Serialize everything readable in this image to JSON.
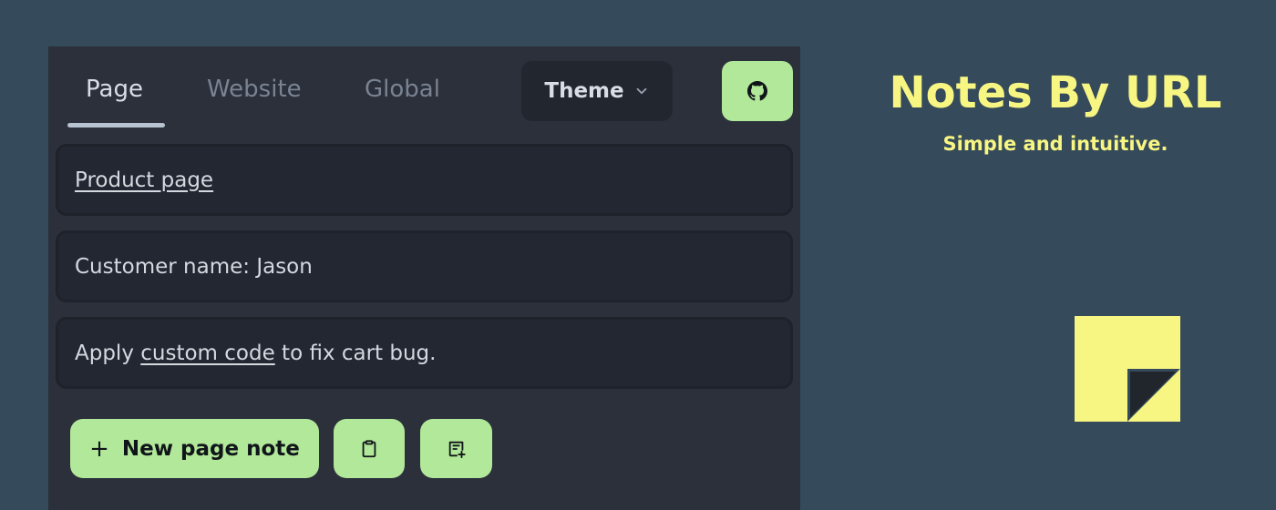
{
  "tabs": [
    {
      "label": "Page",
      "active": true
    },
    {
      "label": "Website",
      "active": false
    },
    {
      "label": "Global",
      "active": false
    }
  ],
  "theme_button": {
    "label": "Theme",
    "icon": "chevron-down-icon"
  },
  "github_button": {
    "icon": "github-icon"
  },
  "notes": [
    {
      "link_text": "Product page"
    },
    {
      "text": "Customer name: Jason"
    },
    {
      "before": "Apply ",
      "link_text": "custom code",
      "after": " to fix cart bug."
    }
  ],
  "actions": {
    "new_note_label": "New page note",
    "new_note_icon": "plus-icon",
    "clipboard_icon": "clipboard-icon",
    "add_note_icon": "note-add-icon"
  },
  "brand": {
    "title": "Notes By URL",
    "subtitle": "Simple and intuitive.",
    "logo_icon": "sticky-note-icon"
  },
  "colors": {
    "background": "#354a5a",
    "panel": "#2b303b",
    "accent_green": "#b2e899",
    "brand_yellow": "#f8f683"
  }
}
